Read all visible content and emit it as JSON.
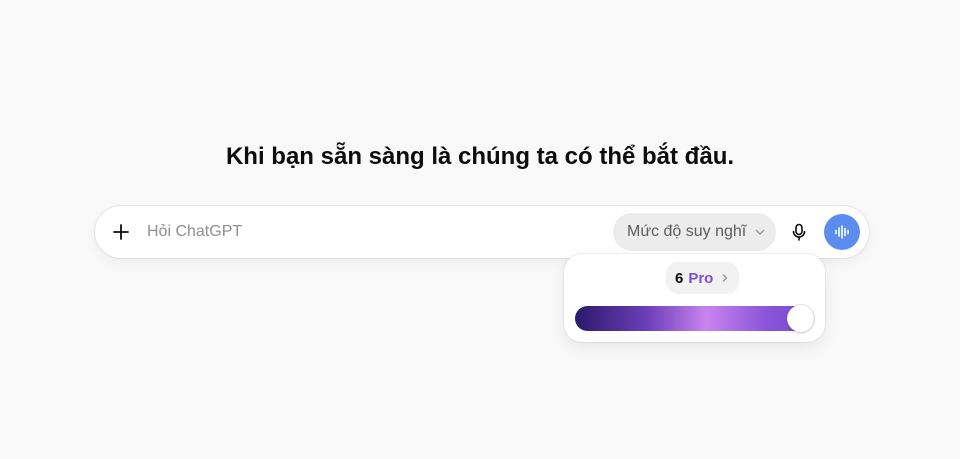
{
  "headline": "Khi bạn sẵn sàng là chúng ta có thể bắt đầu.",
  "composer": {
    "placeholder": "Hỏi ChatGPT",
    "value": "",
    "think_label": "Mức độ suy nghĩ",
    "icons": {
      "add": "plus-icon",
      "think_dropdown": "chevron-down-icon",
      "mic": "microphone-icon",
      "voice": "voice-waveform-icon"
    },
    "voice_color": "#5b8def"
  },
  "thinking_popover": {
    "level_number": "6",
    "level_name": "Pro",
    "level_color": "#7b4fd6",
    "slider_fraction": 1.0,
    "icons": {
      "level_more": "chevron-right-icon"
    }
  }
}
